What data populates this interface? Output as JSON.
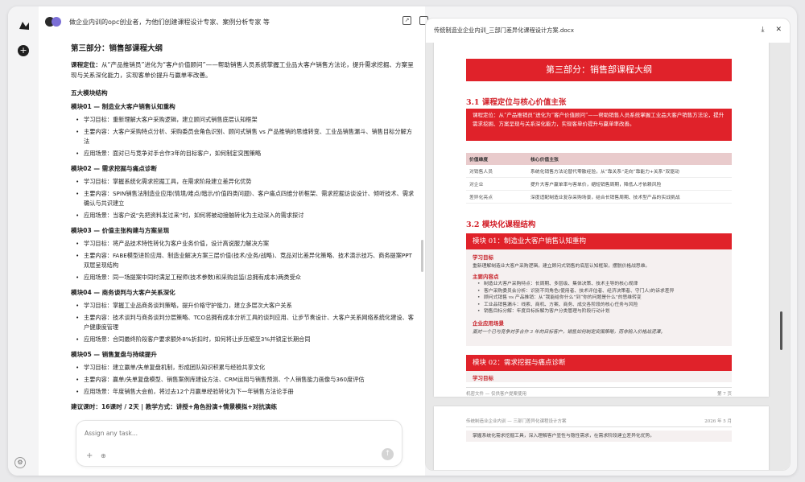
{
  "chat": {
    "title": "做企业内训的opc创业者，为他们创建课程设计专家、案例分析专家 等",
    "section_title": "第三部分：销售部课程大纲",
    "positioning_label": "课程定位：",
    "positioning_text": "从“产品推销员”进化为“客户价值顾问”——帮助销售人员系统掌握工业品大客户销售方法论，提升需求挖掘、方案呈现与关系深化能力，实现客单价提升与赢单率改善。",
    "structure_title": "五大模块结构",
    "modules": [
      {
        "title": "模块01 — 制造业大客户销售认知重构",
        "items": [
          "学习目标：重新理解大客户采购逻辑，建立顾问式销售底层认知框架",
          "主要内容：大客户采购特点分析、采购委员会角色识别、顾问式销售 vs 产品推销的思维转变、工业品销售漏斗、销售目标分解方法",
          "应用场景：面对已与竞争对手合作3年的目标客户，如何制定突围策略"
        ]
      },
      {
        "title": "模块02 — 需求挖掘与痛点诊断",
        "items": [
          "学习目标：掌握系统化需求挖掘工具，在需求阶段建立差异化优势",
          "主要内容：SPIN销售法制造业应用(情境/难点/暗示/价值四类问题)、客户痛点四维分析框架、需求挖掘访谈设计、倾听技术、需求确认与共识建立",
          "应用场景：当客户说“先把资料发过来”时，如何将被动接触转化为主动深入的需求探讨"
        ]
      },
      {
        "title": "模块03 — 价值主张构建与方案呈现",
        "items": [
          "学习目标：将产品技术特性转化为客户业务价值，设计高说服力解决方案",
          "主要内容：FABE模型进阶应用、制造业解决方案三层价值(技术/业务/战略)、竞品对比差异化策略、技术演示技巧、商务提案PPT双层呈现结构",
          "应用场景：同一场提案中同时满足工程师(技术参数)和采购总监(总拥有成本)两类受众"
        ]
      },
      {
        "title": "模块04 — 商务谈判与大客户关系深化",
        "items": [
          "学习目标：掌握工业品商务谈判策略，提升价格守护能力，建立多层次大客户关系",
          "主要内容：技术谈判与商务谈判分层策略、TCO总拥有成本分析工具的谈判应用、让步节奏设计、大客户关系网络系统化建设、客户健康度管理",
          "应用场景：合同最终阶段客户要求额外8%折扣时，如何将让步压缩至3%并锁定长期合同"
        ]
      },
      {
        "title": "模块05 — 销售复盘与持续提升",
        "items": [
          "学习目标：建立赢单/失单复盘机制，形成团队知识积累与经验共享文化",
          "主要内容：赢单/失单复盘模型、销售案例库建设方法、CRM运用与销售预测、个人销售能力画像与360度评估",
          "应用场景：年度销售大会前，将过去12个月赢单经验转化为下一年销售方法论手册"
        ]
      }
    ],
    "hours": "建议课时：16课时 / 2天 | 教学方式：讲授+角色扮演+情景模拟+对抗演练"
  },
  "composer": {
    "placeholder": "Assign any task..."
  },
  "viewer": {
    "filename": "传统制造业企业内训_三部门差异化课程设计方案.docx",
    "section_banner": "第三部分：销售部课程大纲",
    "h31": "3.1 课程定位与核心价值主张",
    "positioning": "课程定位：从“产品推销员”进化为“客户价值顾问”——帮助销售人员系统掌握工业品大客户销售方法论，提升需求挖掘、方案呈现与关系深化能力，实现客单价提升与赢单率改善。",
    "table_headers": [
      "价值维度",
      "核心价值主张"
    ],
    "table_rows": [
      [
        "对销售人员",
        "系统化销售方法论替代零散经验，从“靠关系”走向“靠能力+关系”双驱动"
      ],
      [
        "对企业",
        "提升大客户赢单率与客单价，缩短销售周期，降低人才依赖风险"
      ],
      [
        "差异化亮点",
        "深度适配制造业复杂采购场景，结合长销售周期、技术型产品的实战挑战"
      ]
    ],
    "h32": "3.2 模块化课程结构",
    "module1_banner": "模块 01：制造业大客户销售认知重构",
    "learn_label": "学习目标",
    "learn_text": "重新理解制造业大客户采购逻辑，建立顾问式销售的底层认知框架，摆脱价格战思维。",
    "content_label": "主要内容点",
    "content_items": [
      "制造业大客户采购特点：长周期、多层级、集体决策、技术主导的核心规律",
      "客户采购委员会分析：识别不同角色(使用者、技术评估者、经济决策者、守门人)的诉求差异",
      "顾问式销售 vs 产品推销：从“我能给你什么”到“你的问题是什么”的思维转变",
      "工业品销售漏斗：线索、商机、方案、商务、成交各阶段的核心任务与风险",
      "销售目标分解：年度目标拆解为客户分类管理与阶段行动计划"
    ],
    "scene_label": "企业应用场景",
    "scene_text": "面对一个已与竞争对手合作 3 年的目标客户，销售如何制定突围策略，而非陷入价格战泥潭。",
    "module2_banner": "模块 02：需求挖掘与痛点诊断",
    "learn2_label": "学习目标",
    "footer_left": "机密文件 — 仅供客户提案使用",
    "footer_right": "第 7 页",
    "p2_header_left": "传统制造业企业内训 — 三部门差异化课程设计方案",
    "p2_header_right": "2026 年 5 月",
    "p2_bar": "掌握系统化需求挖掘工具，深入理解客户显性与隐性需求，在需求阶段建立差异化优势。"
  }
}
